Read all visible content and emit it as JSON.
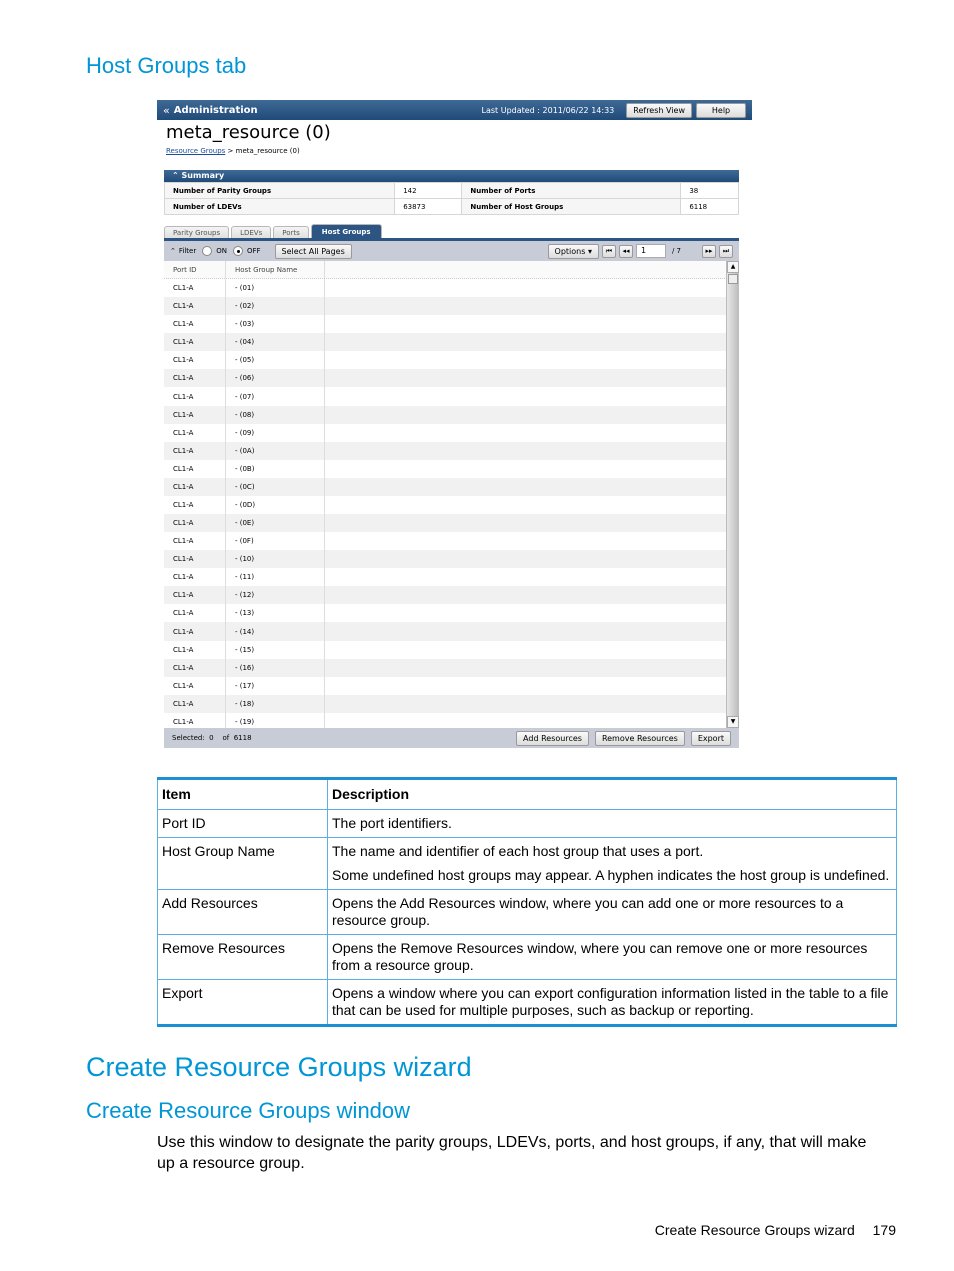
{
  "headings": {
    "host_groups_tab": "Host Groups tab",
    "wizard": "Create Resource Groups wizard",
    "window": "Create Resource Groups window"
  },
  "intro": "Use this window to designate the parity groups, LDEVs, ports, and host groups, if any, that will make up a resource group.",
  "footer": {
    "section": "Create Resource Groups wizard",
    "page": "179"
  },
  "app": {
    "nav_icon": "double-chevron-left-icon",
    "nav_title": "Administration",
    "last_updated": "Last Updated : 2011/06/22 14:33",
    "refresh_label": "Refresh View",
    "help_label": "Help",
    "page_title": "meta_resource (0)",
    "breadcrumb_link": "Resource Groups",
    "breadcrumb_sep": ">",
    "breadcrumb_current": "meta_resource (0)",
    "summary": {
      "title": "Summary",
      "rows": [
        {
          "k1": "Number of Parity Groups",
          "v1": "142",
          "k2": "Number of Ports",
          "v2": "38"
        },
        {
          "k1": "Number of LDEVs",
          "v1": "63873",
          "k2": "Number of Host Groups",
          "v2": "6118"
        }
      ]
    },
    "tabs": [
      "Parity Groups",
      "LDEVs",
      "Ports",
      "Host Groups"
    ],
    "active_tab": "Host Groups",
    "filter": {
      "label": "Filter",
      "on": "ON",
      "off": "OFF",
      "selected": "OFF",
      "select_all": "Select All Pages"
    },
    "options_label": "Options",
    "pagination": {
      "current": "1",
      "total": "/ 7"
    },
    "columns": [
      "Port ID",
      "Host Group Name"
    ],
    "rows": [
      [
        "CL1-A",
        "- (01)"
      ],
      [
        "CL1-A",
        "- (02)"
      ],
      [
        "CL1-A",
        "- (03)"
      ],
      [
        "CL1-A",
        "- (04)"
      ],
      [
        "CL1-A",
        "- (05)"
      ],
      [
        "CL1-A",
        "- (06)"
      ],
      [
        "CL1-A",
        "- (07)"
      ],
      [
        "CL1-A",
        "- (08)"
      ],
      [
        "CL1-A",
        "- (09)"
      ],
      [
        "CL1-A",
        "- (0A)"
      ],
      [
        "CL1-A",
        "- (0B)"
      ],
      [
        "CL1-A",
        "- (0C)"
      ],
      [
        "CL1-A",
        "- (0D)"
      ],
      [
        "CL1-A",
        "- (0E)"
      ],
      [
        "CL1-A",
        "- (0F)"
      ],
      [
        "CL1-A",
        "- (10)"
      ],
      [
        "CL1-A",
        "- (11)"
      ],
      [
        "CL1-A",
        "- (12)"
      ],
      [
        "CL1-A",
        "- (13)"
      ],
      [
        "CL1-A",
        "- (14)"
      ],
      [
        "CL1-A",
        "- (15)"
      ],
      [
        "CL1-A",
        "- (16)"
      ],
      [
        "CL1-A",
        "- (17)"
      ],
      [
        "CL1-A",
        "- (18)"
      ],
      [
        "CL1-A",
        "- (19)"
      ]
    ],
    "selected_text": "Selected:  0    of  6118",
    "buttons": {
      "add": "Add Resources",
      "remove": "Remove Resources",
      "export": "Export"
    }
  },
  "desc_table": {
    "headers": [
      "Item",
      "Description"
    ],
    "rows": [
      {
        "item": "Port ID",
        "desc": [
          "The port identifiers."
        ]
      },
      {
        "item": "Host Group Name",
        "desc": [
          "The name and identifier of each host group that uses a port.",
          "Some undefined host groups may appear. A hyphen indicates the host group is undefined."
        ]
      },
      {
        "item": "Add Resources",
        "desc": [
          "Opens the Add Resources window, where you can add one or more resources to a resource group."
        ]
      },
      {
        "item": "Remove Resources",
        "desc": [
          "Opens the Remove Resources window, where you can remove one or more resources from a resource group."
        ]
      },
      {
        "item": "Export",
        "desc": [
          "Opens a window where you can export configuration information listed in the table to a file that can be used for multiple purposes, such as backup or reporting."
        ]
      }
    ]
  }
}
